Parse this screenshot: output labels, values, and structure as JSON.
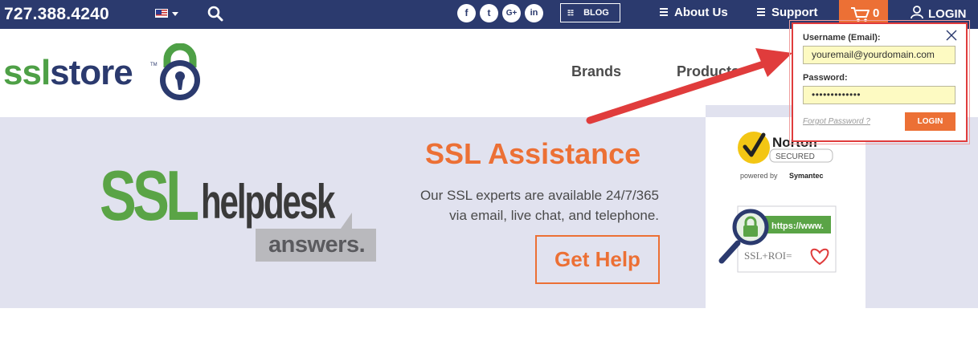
{
  "topbar": {
    "phone": "727.388.4240",
    "social": {
      "facebook": "f",
      "twitter": "t",
      "googleplus": "G+",
      "linkedin": "in"
    },
    "blog_label": "BLOG",
    "about_label": "About Us",
    "support_label": "Support",
    "cart_count": "0",
    "login_label": "LOGIN"
  },
  "header": {
    "logo_part1": "ssl",
    "logo_part2": "store",
    "logo_tm": "TM",
    "nav": [
      "Brands",
      "Products"
    ]
  },
  "hero": {
    "logo_ssl": "SSL",
    "logo_help": "helpdesk",
    "logo_answers": "answers.",
    "title": "SSL Assistance",
    "description_line1": "Our SSL experts are available 24/7/365",
    "description_line2": "via email, live chat, and telephone.",
    "cta_label": "Get Help"
  },
  "badges": {
    "norton_name": "Norton",
    "norton_secured": "SECURED",
    "norton_powered": "powered by",
    "norton_symantec": "Symantec",
    "roi_url": "https://www.",
    "roi_text": "SSL+ROI="
  },
  "login_popup": {
    "username_label": "Username (Email):",
    "username_value": "youremail@yourdomain.com",
    "password_label": "Password:",
    "password_value": "•••••••••••••",
    "forgot_label": "Forgot Password ?",
    "login_button": "LOGIN"
  },
  "colors": {
    "navy": "#2b3a6e",
    "orange": "#ec7035",
    "green": "#4ea046",
    "hero_bg": "#e1e2ef",
    "callout_red": "#e03c3c"
  }
}
